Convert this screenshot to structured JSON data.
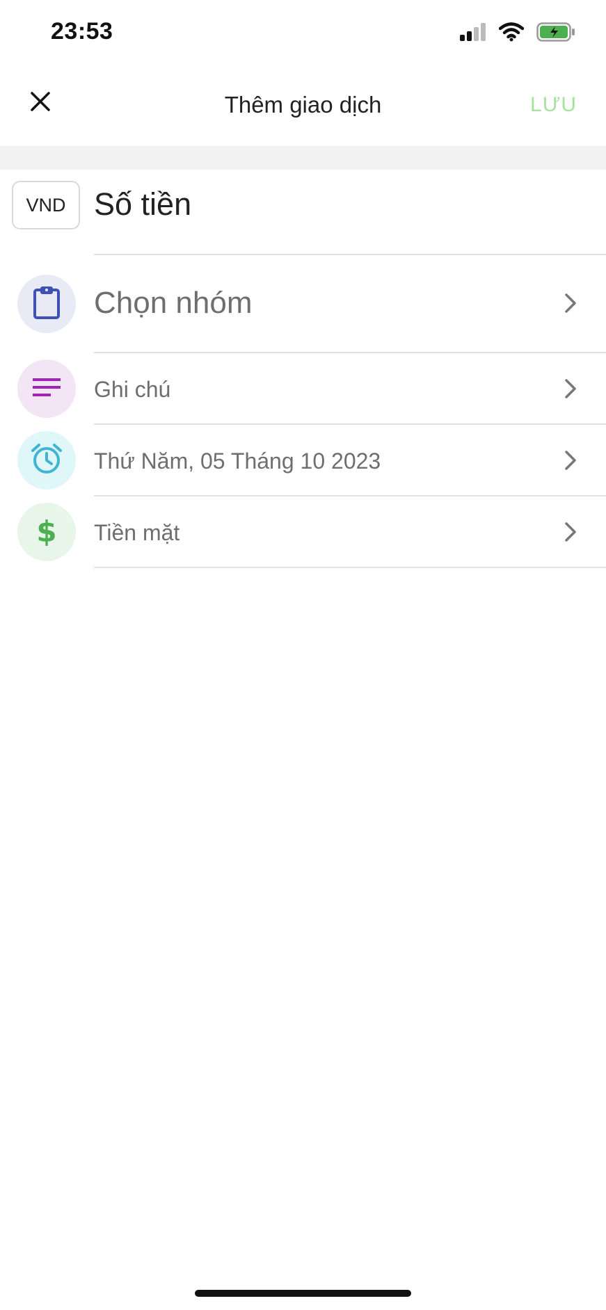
{
  "status_bar": {
    "time": "23:53",
    "icons": [
      "signal-icon",
      "wifi-icon",
      "battery-charging-icon"
    ],
    "battery_color": "#4caf50"
  },
  "header": {
    "title": "Thêm giao dịch",
    "close_icon": "close-icon",
    "save_label": "LƯU",
    "save_color": "#a8e0a0"
  },
  "amount": {
    "currency": "VND",
    "placeholder": "Số tiền"
  },
  "fields": {
    "category": {
      "label": "Chọn nhóm",
      "icon": "clipboard-icon",
      "color": "#3f51b5"
    },
    "note": {
      "label": "Ghi chú",
      "icon": "notes-lines-icon",
      "color": "#9c27b0"
    },
    "date": {
      "label": "Thứ Năm, 05 Tháng 10 2023",
      "icon": "alarm-clock-icon",
      "color": "#3fb5d3"
    },
    "wallet": {
      "label": "Tiền mặt",
      "icon": "dollar-icon",
      "color": "#4caf50"
    }
  }
}
